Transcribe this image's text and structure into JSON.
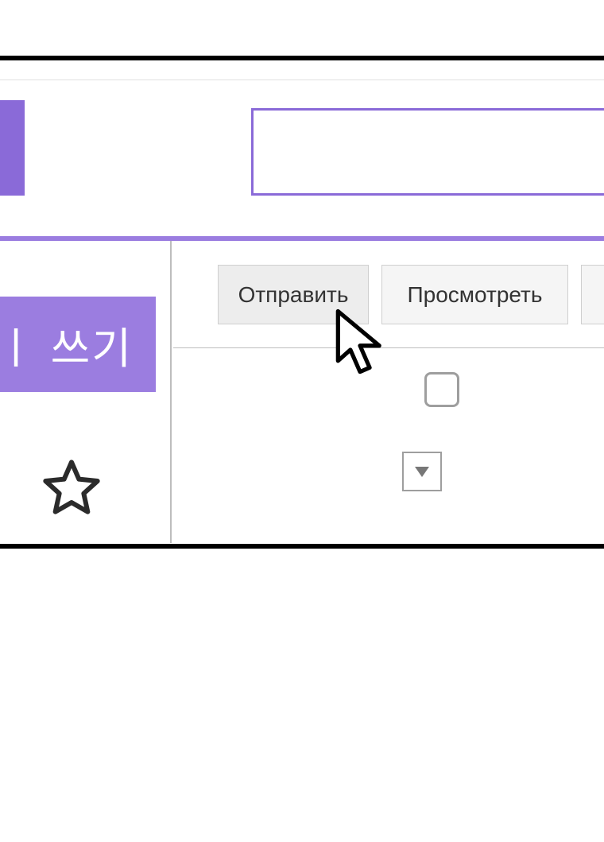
{
  "header": {
    "search_value": "",
    "search_placeholder": ""
  },
  "sidebar": {
    "compose_label": "ㅣ 쓰기",
    "star_label": "star"
  },
  "toolbar": {
    "send_label": "Отправить",
    "preview_label": "Просмотреть"
  },
  "icons": {
    "cursor": "cursor-icon",
    "star": "star-icon",
    "dropdown": "chevron-down-icon",
    "checkbox": "checkbox-icon",
    "logo": "mail-logo-icon"
  },
  "colors": {
    "accent": "#9b7de0",
    "accent_dark": "#8a6ad8",
    "button_bg": "#f5f5f5",
    "border": "#bdbdbd"
  }
}
